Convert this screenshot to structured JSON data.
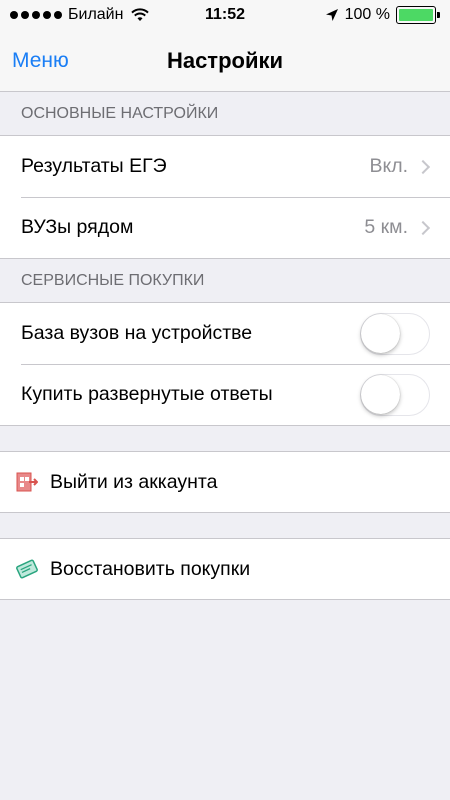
{
  "status_bar": {
    "carrier": "Билайн",
    "time": "11:52",
    "battery_text": "100 %",
    "battery_level": 1.0,
    "battery_color": "#4cd964"
  },
  "nav": {
    "back_label": "Меню",
    "title": "Настройки",
    "accent_color": "#1a7ef5"
  },
  "sections": {
    "main_header": "ОСНОВНЫЕ НАСТРОЙКИ",
    "exam_results_label": "Результаты ЕГЭ",
    "exam_results_value": "Вкл.",
    "nearby_label": "ВУЗы рядом",
    "nearby_value": "5 км.",
    "service_header": "СЕРВИСНЫЕ ПОКУПКИ",
    "db_label": "База вузов на устройстве",
    "db_toggle_on": false,
    "answers_label": "Купить развернутые ответы",
    "answers_toggle_on": false
  },
  "actions": {
    "logout_label": "Выйти из аккаунта",
    "logout_icon": "logout-icon",
    "restore_label": "Восстановить покупки",
    "restore_icon": "restore-purchases-icon"
  }
}
